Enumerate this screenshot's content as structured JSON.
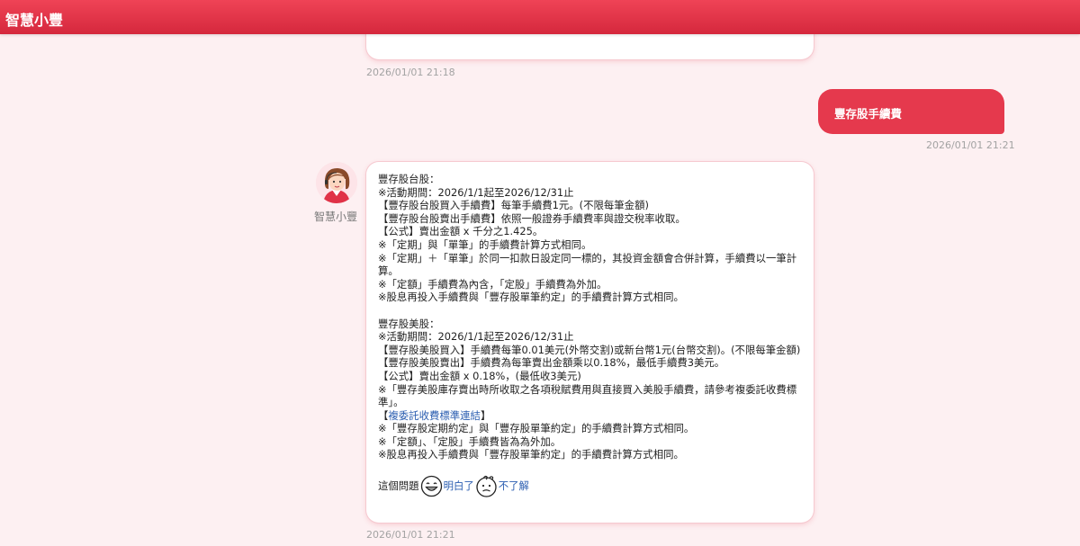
{
  "header": {
    "title": "智慧小豐"
  },
  "messages": {
    "prev_bot_time": "2026/01/01 21:18",
    "user": {
      "text": "豐存股手續費",
      "time": "2026/01/01 21:21"
    },
    "bot": {
      "name": "智慧小豐",
      "time": "2026/01/01 21:21",
      "tw_lines": [
        "豐存股台股：",
        "※活動期間：2026/1/1起至2026/12/31止",
        "【豐存股台股買入手續費】每筆手續費1元。(不限每筆金額)",
        "【豐存股台股賣出手續費】依照一般證券手續費率與證交稅率收取。",
        "【公式】賣出金額 x 千分之1.425。",
        "※「定期」與「單筆」的手續費計算方式相同。",
        "※「定期」＋「單筆」於同一扣款日設定同一標的，其投資金額會合併計算，手續費以一筆計算。",
        "※「定額」手續費為內含，「定股」手續費為外加。",
        "※股息再投入手續費與「豐存股單筆約定」的手續費計算方式相同。"
      ],
      "us_lines": [
        "豐存股美股：",
        "※活動期間：2026/1/1起至2026/12/31止",
        "【豐存股美股買入】手續費每筆0.01美元(外幣交割)或新台幣1元(台幣交割)。(不限每筆金額)",
        "【豐存股美股賣出】手續費為每筆賣出金額乘以0.18%，最低手續費3美元。",
        "【公式】賣出金額 x 0.18%，(最低收3美元)",
        "※「豐存美股庫存賣出時所收取之各項稅賦費用與直接買入美股手續費，請參考複委託收費標準」。"
      ],
      "link_prefix": "【",
      "link_text": "複委託收費標準連結",
      "link_suffix": "】",
      "us_tail_lines": [
        "※「豐存股定期約定」與「豐存股單筆約定」的手續費計算方式相同。",
        "※「定額」、「定股」手續費皆為為外加。",
        "※股息再投入手續費與「豐存股單筆約定」的手續費計算方式相同。"
      ],
      "feedback": {
        "question": "這個問題",
        "understood": "明白了",
        "not_understood": "不了解"
      }
    }
  }
}
